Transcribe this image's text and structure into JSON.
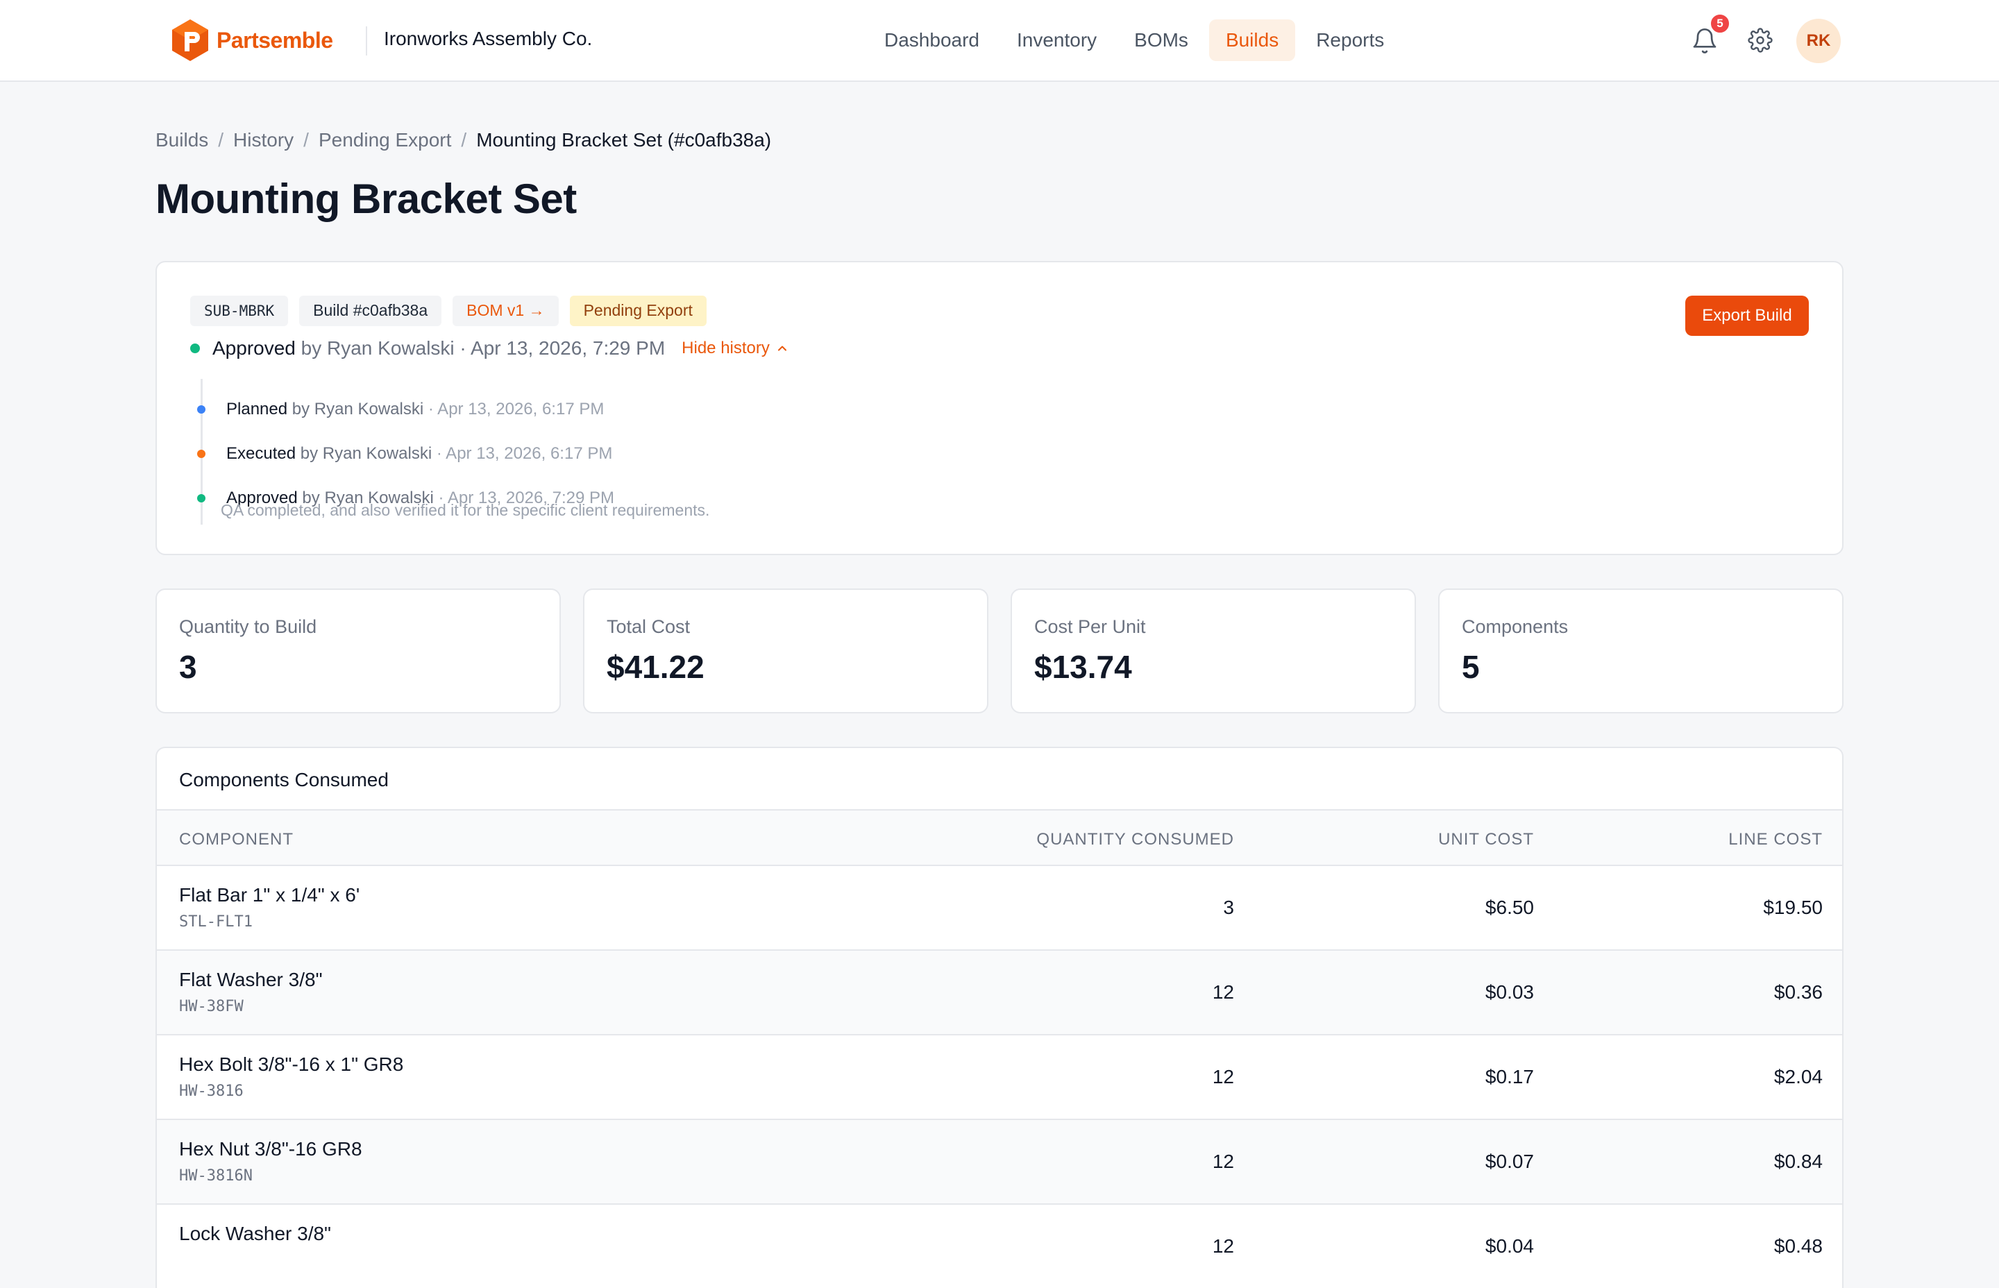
{
  "header": {
    "brand": "Partsemble",
    "org": "Ironworks Assembly Co.",
    "nav": [
      "Dashboard",
      "Inventory",
      "BOMs",
      "Builds",
      "Reports"
    ],
    "active_nav": "Builds",
    "notification_count": "5",
    "avatar_initials": "RK",
    "brand_color": "#ea580c"
  },
  "breadcrumb": {
    "items": [
      "Builds",
      "History",
      "Pending Export"
    ],
    "current": "Mounting Bracket Set (#c0afb38a)",
    "separator": "/"
  },
  "page_title": "Mounting Bracket Set",
  "status_card": {
    "chips": {
      "sku": "SUB-MBRK",
      "build": "Build #c0afb38a",
      "bom": "BOM v1 →",
      "status": "Pending Export"
    },
    "export_button": "Export Build",
    "current_status": {
      "label": "Approved",
      "by": "by Ryan Kowalski",
      "time": "· Apr 13, 2026, 7:29 PM"
    },
    "hide_history": "Hide history",
    "history": [
      {
        "label": "Planned",
        "by": "by Ryan Kowalski",
        "time": "· Apr 13, 2026, 6:17 PM",
        "color": "#3b82f6"
      },
      {
        "label": "Executed",
        "by": "by Ryan Kowalski",
        "time": "· Apr 13, 2026, 6:17 PM",
        "color": "#f97316"
      },
      {
        "label": "Approved",
        "by": "by Ryan Kowalski",
        "time": "· Apr 13, 2026, 7:29 PM",
        "color": "#10b981"
      }
    ],
    "history_note": "QA completed, and also verified it for the specific client requirements."
  },
  "stats": [
    {
      "label": "Quantity to Build",
      "value": "3"
    },
    {
      "label": "Total Cost",
      "value": "$41.22"
    },
    {
      "label": "Cost Per Unit",
      "value": "$13.74"
    },
    {
      "label": "Components",
      "value": "5"
    }
  ],
  "components_table": {
    "title": "Components Consumed",
    "columns": [
      "Component",
      "Quantity Consumed",
      "Unit Cost",
      "Line Cost"
    ],
    "rows": [
      {
        "name": "Flat Bar 1\" x 1/4\" x 6'",
        "sku": "STL-FLT1",
        "qty": "3",
        "unit": "$6.50",
        "line": "$19.50"
      },
      {
        "name": "Flat Washer 3/8\"",
        "sku": "HW-38FW",
        "qty": "12",
        "unit": "$0.03",
        "line": "$0.36"
      },
      {
        "name": "Hex Bolt 3/8\"-16 x 1\" GR8",
        "sku": "HW-3816",
        "qty": "12",
        "unit": "$0.17",
        "line": "$2.04"
      },
      {
        "name": "Hex Nut 3/8\"-16 GR8",
        "sku": "HW-3816N",
        "qty": "12",
        "unit": "$0.07",
        "line": "$0.84"
      },
      {
        "name": "Lock Washer 3/8\"",
        "sku": "",
        "qty": "12",
        "unit": "$0.04",
        "line": "$0.48"
      }
    ]
  }
}
